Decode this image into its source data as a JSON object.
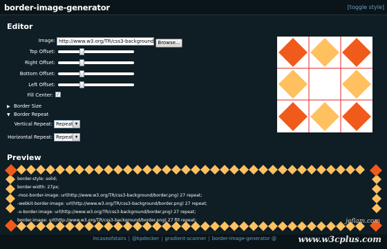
{
  "app": {
    "title": "border-image-generator",
    "toggle_style": "[toggle style]"
  },
  "editor": {
    "title": "Editor",
    "image_label": "Image:",
    "image_value": "http://www.w3.org/TR/css3-background/bor",
    "browse_label": "Browse...",
    "sliders": [
      {
        "label": "Top Offset:",
        "level": 0.3
      },
      {
        "label": "Right Offset:",
        "level": 0.3
      },
      {
        "label": "Bottom Offset:",
        "level": 0.3
      },
      {
        "label": "Left Offset:",
        "level": 0.3
      }
    ],
    "fill_center_label": "Fill Center:",
    "fill_center_checked": true,
    "border_size_label": "Border Size",
    "border_repeat_label": "Border Repeat",
    "vertical_repeat_label": "Vertical Repeat:",
    "vertical_repeat_value": "Repeat",
    "horizontal_repeat_label": "Horizontal Repeat:",
    "horizontal_repeat_value": "Repeat"
  },
  "preview": {
    "title": "Preview",
    "code_lines": [
      "border-style: solid;",
      "border-width: 27px;",
      "-moz-border-image: url(http://www.w3.org/TR/css3-background/border.png) 27 repeat;",
      "-webkit-border-image: url(http://www.w3.org/TR/css3-background/border.png) 27 repeat;",
      "-o-border-image: url(http://www.w3.org/TR/css3-background/border.png) 27 repeat;",
      "border-image: url(http://www.w3.org/TR/css3-background/border.png) 27 fill repeat;"
    ]
  },
  "footer": {
    "links": [
      "incaseofstairs",
      "@kpdecker",
      "gradient-scanner",
      "border-image-generator @"
    ],
    "watermark_small": "jeflam.com",
    "watermark_big": "www.w3cplus.com"
  },
  "colors": {
    "background": "#0f1d24",
    "diamond_red": "#f05a1a",
    "diamond_orange": "#ffc060",
    "grid_line": "#e02020",
    "link": "#6aa4c6"
  }
}
